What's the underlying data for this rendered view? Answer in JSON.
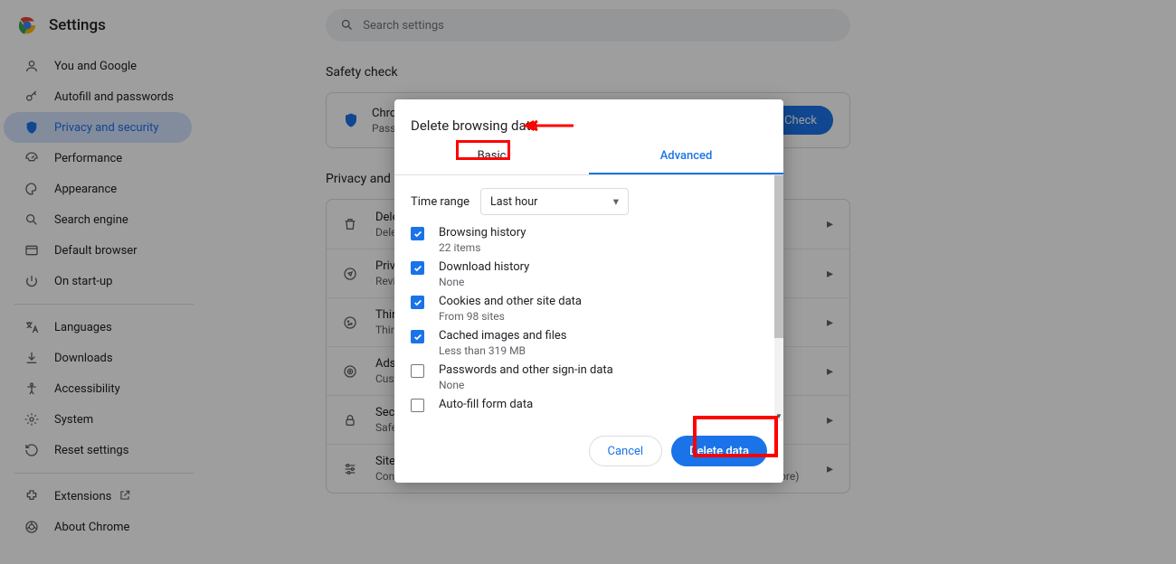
{
  "header": {
    "title": "Settings"
  },
  "search": {
    "placeholder": "Search settings"
  },
  "sidebar": {
    "items": [
      {
        "label": "You and Google"
      },
      {
        "label": "Autofill and passwords"
      },
      {
        "label": "Privacy and security"
      },
      {
        "label": "Performance"
      },
      {
        "label": "Appearance"
      },
      {
        "label": "Search engine"
      },
      {
        "label": "Default browser"
      },
      {
        "label": "On start-up"
      }
    ],
    "items2": [
      {
        "label": "Languages"
      },
      {
        "label": "Downloads"
      },
      {
        "label": "Accessibility"
      },
      {
        "label": "System"
      },
      {
        "label": "Reset settings"
      }
    ],
    "items3": [
      {
        "label": "Extensions"
      },
      {
        "label": "About Chrome"
      }
    ]
  },
  "main": {
    "safety_title": "Safety check",
    "safety_row": {
      "title": "Chro",
      "sub": "Passw"
    },
    "safety_button": "ty Check",
    "privacy_title": "Privacy and s",
    "rows": [
      {
        "title": "Dele",
        "sub": "Dele"
      },
      {
        "title": "Priva",
        "sub": "Revie"
      },
      {
        "title": "Third",
        "sub": "Third"
      },
      {
        "title": "Ads p",
        "sub": "Custo"
      },
      {
        "title": "Secu",
        "sub": "Safe"
      },
      {
        "title": "Site s",
        "sub": "Controls what information sites can use and show (location, camera, pop-ups and more)"
      }
    ]
  },
  "dialog": {
    "title": "Delete browsing data",
    "tab_basic": "Basic",
    "tab_advanced": "Advanced",
    "time_label": "Time range",
    "time_value": "Last hour",
    "options": [
      {
        "title": "Browsing history",
        "sub": "22 items",
        "checked": true
      },
      {
        "title": "Download history",
        "sub": "None",
        "checked": true
      },
      {
        "title": "Cookies and other site data",
        "sub": "From 98 sites",
        "checked": true
      },
      {
        "title": "Cached images and files",
        "sub": "Less than 319 MB",
        "checked": true
      },
      {
        "title": "Passwords and other sign-in data",
        "sub": "None",
        "checked": false
      },
      {
        "title": "Auto-fill form data",
        "sub": "",
        "checked": false
      }
    ],
    "cancel": "Cancel",
    "delete": "Delete data"
  }
}
